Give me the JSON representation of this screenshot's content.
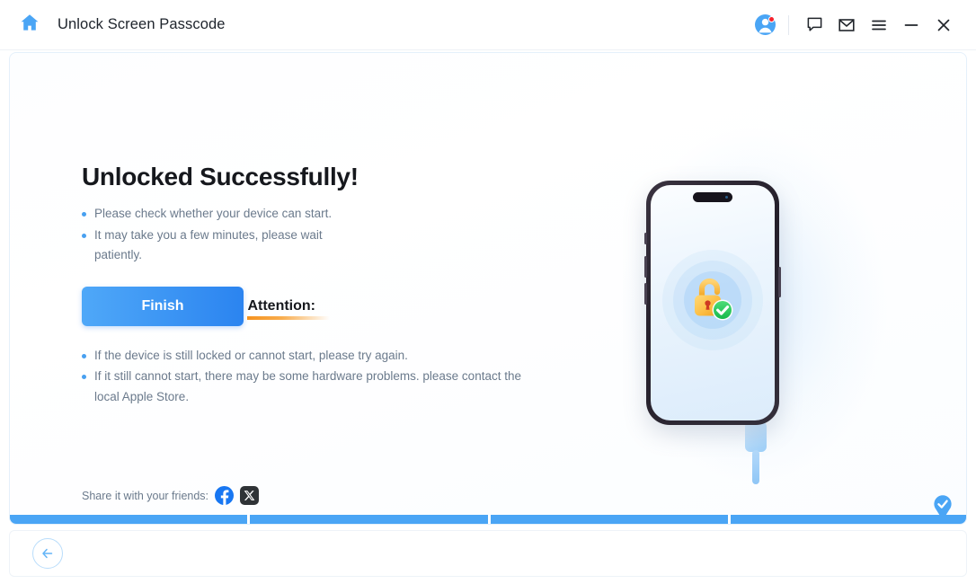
{
  "titlebar": {
    "home_icon": "home-icon",
    "title": "Unlock Screen Passcode",
    "actions": [
      {
        "name": "account-avatar",
        "icon": "user-avatar-icon",
        "badge": true
      },
      {
        "name": "feedback-button",
        "icon": "chat-bubble-icon"
      },
      {
        "name": "mail-button",
        "icon": "envelope-icon"
      },
      {
        "name": "menu-button",
        "icon": "hamburger-menu-icon"
      },
      {
        "name": "minimize-button",
        "icon": "minimize-icon"
      },
      {
        "name": "close-button",
        "icon": "close-icon"
      }
    ]
  },
  "main": {
    "headline": "Unlocked Successfully!",
    "notes": [
      "Please check whether your device can start.",
      "It may take you a few minutes, please wait patiently."
    ],
    "finish_label": "Finish",
    "attention_title": "Attention:",
    "attention_notes": [
      "If the device is still locked or cannot start, please try again.",
      "If it still cannot start, there may be some hardware problems. please contact the local Apple Store."
    ],
    "share_label": "Share it with your friends:",
    "share_targets": [
      {
        "name": "facebook-share-button",
        "icon": "facebook-icon",
        "color": "#1877f2"
      },
      {
        "name": "x-share-button",
        "icon": "x-twitter-icon",
        "color": "#2f3336"
      }
    ]
  },
  "illustration": {
    "device": "iphone-device",
    "screen_icon": "unlocked-padlock-with-check-icon",
    "accessory": "lightning-cable-icon"
  },
  "progress": {
    "segments": 4,
    "completed": 4,
    "end_badge": "checkmark-pin-icon"
  },
  "footer": {
    "back_label": "back-arrow-icon"
  },
  "colors": {
    "accent": "#4aa5f5",
    "button_from": "#4fa8f8",
    "button_to": "#2b84f0",
    "attention_rule": "#f5921e",
    "notification_dot": "#f5222d",
    "text_body": "#6b7a8c",
    "text_heading": "#16181d"
  }
}
